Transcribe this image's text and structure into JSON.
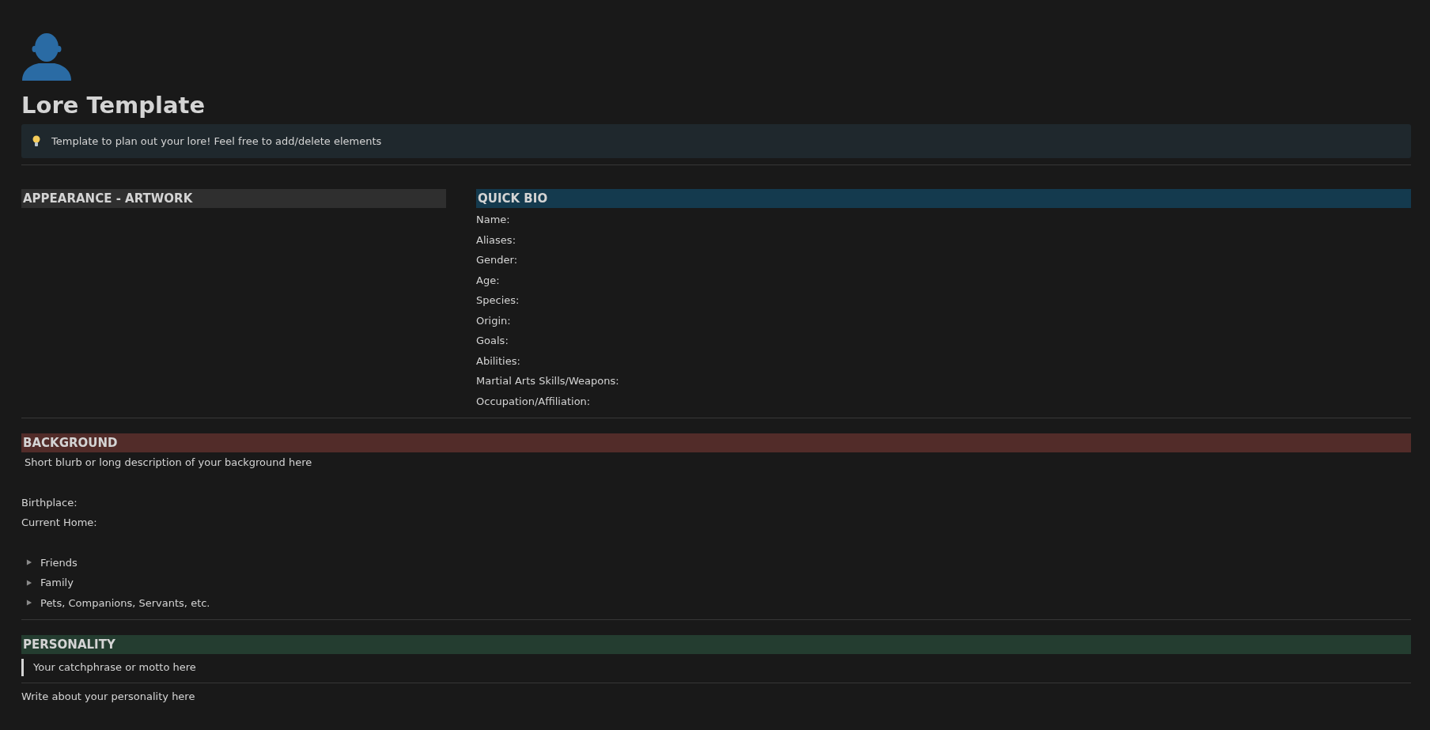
{
  "title": "Lore Template",
  "callout": {
    "text": "Template to plan out your lore! Feel free to add/delete elements"
  },
  "appearance": {
    "heading": "APPEARANCE - ARTWORK"
  },
  "quick_bio": {
    "heading": "QUICK BIO",
    "fields": [
      "Name:",
      "Aliases:",
      "Gender:",
      "Age:",
      "Species:",
      "Origin:",
      "Goals:",
      "Abilities:",
      "Martial Arts Skills/Weapons:",
      "Occupation/Affiliation:"
    ]
  },
  "background": {
    "heading": "BACKGROUND",
    "description": "Short blurb or long description of your background here",
    "fields": [
      "Birthplace:",
      "Current Home:"
    ],
    "toggles": [
      {
        "label": "Friends",
        "expanded": false
      },
      {
        "label": "Family",
        "expanded": false
      },
      {
        "label": "Pets, Companions, Servants, etc.",
        "expanded": false
      }
    ]
  },
  "personality": {
    "heading": "PERSONALITY",
    "quote": "Your catchphrase or motto here",
    "text": "Write about your personality here"
  }
}
